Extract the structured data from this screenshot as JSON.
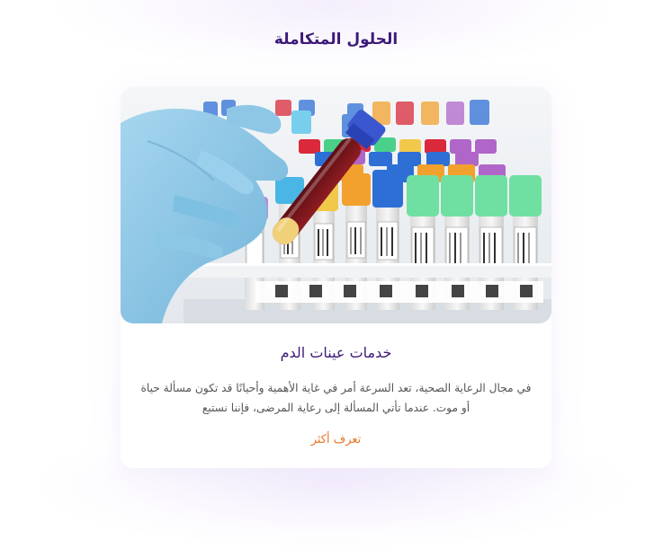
{
  "section": {
    "title": "الحلول المتكاملة"
  },
  "card": {
    "title": "خدمات عينات الدم",
    "description": "في مجال الرعاية الصحية، تعد السرعة أمر في غاية الأهمية وأحيانًا قد تكون مسألة حياة أو موت. عندما تأتي المسألة إلى رعاية المرضى، فإننا نستبع",
    "link_label": "تعرف أكثر",
    "image_subject": "blood-sample-tubes-photo"
  },
  "colors": {
    "title": "#3d1a78",
    "link": "#e8742a",
    "body_text": "#555555",
    "glove": "#8ec7e6"
  }
}
